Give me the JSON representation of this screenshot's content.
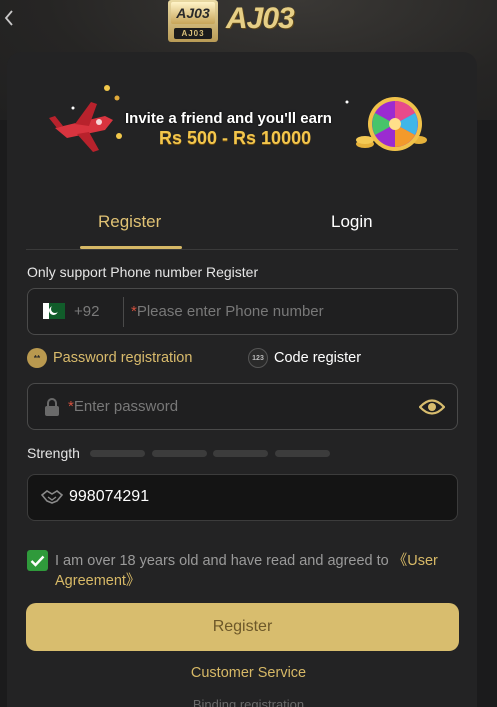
{
  "header": {
    "logo_badge_top": "AJ03",
    "logo_badge_bottom": "AJ03",
    "logo_text": "AJ03"
  },
  "banner": {
    "line1": "Invite a friend and you'll earn",
    "line2": "Rs 500 - Rs 10000"
  },
  "tabs": [
    {
      "label": "Register",
      "active": true
    },
    {
      "label": "Login",
      "active": false
    }
  ],
  "form": {
    "note": "Only support Phone number Register",
    "phone": {
      "country_code": "+92",
      "required_mark": "*",
      "placeholder": "Please enter Phone number"
    },
    "methods": [
      {
        "label": "Password registration",
        "icon_text": "**",
        "active": true
      },
      {
        "label": "Code register",
        "icon_text": "123",
        "active": false
      }
    ],
    "password": {
      "required_mark": "*",
      "placeholder": "Enter password"
    },
    "strength": {
      "label": "Strength",
      "level": 0
    },
    "invite_code": {
      "value": "998074291"
    },
    "agreement": {
      "checked": true,
      "text": "I am over 18 years old and have read and agreed to ",
      "link": "《User Agreement》"
    },
    "submit_label": "Register"
  },
  "footer": {
    "customer_service": "Customer Service",
    "binding": "Binding registration"
  },
  "colors": {
    "accent_gold": "#d8bd6e",
    "background": "#1b1b1c",
    "panel": "#232324",
    "check_green": "#2f9a3b",
    "required_red": "#d2503e"
  },
  "icons": [
    "back-arrow-icon",
    "pakistan-flag-icon",
    "lock-icon",
    "eye-icon",
    "handshake-icon",
    "checkmark-icon",
    "airplane-icon",
    "prize-wheel-icon"
  ]
}
